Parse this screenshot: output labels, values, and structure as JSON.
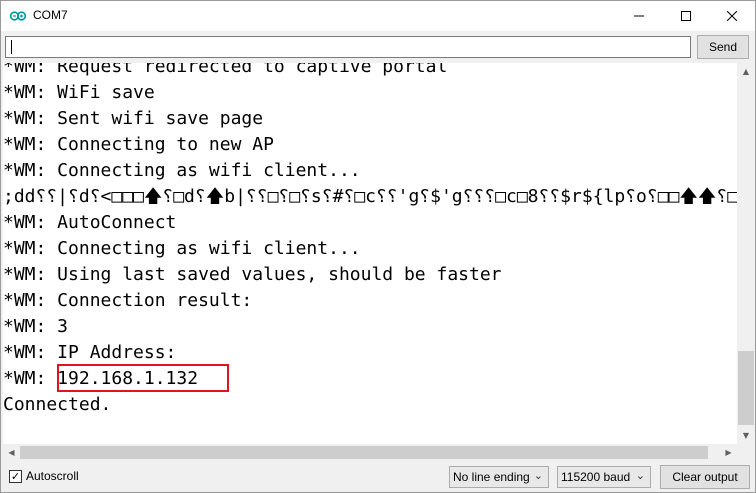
{
  "window": {
    "title": "COM7",
    "icons": {
      "app": "arduino-logo-icon",
      "minimize": "minimize-icon",
      "maximize": "maximize-icon",
      "close": "close-icon"
    }
  },
  "send_row": {
    "input_value": "",
    "send_label": "Send"
  },
  "output": {
    "lines": [
      "*WM: Request redirected to captive portal",
      "*WM: WiFi save",
      "*WM: Sent wifi save page",
      "*WM: Connecting to new AP",
      "*WM: Connecting as wifi client...",
      ";dd⸮⸮|⸮d⸮<□□□🡅⸮□d⸮🡅b|⸮⸮□⸮□⸮s⸮#⸮□c⸮⸮'g⸮$'g⸮⸮⸮□c□8⸮⸮$r${lp⸮o⸮□□🡅🡅⸮□c",
      "*WM: AutoConnect",
      "*WM: Connecting as wifi client...",
      "*WM: Using last saved values, should be faster",
      "*WM: Connection result:",
      "*WM: 3",
      "*WM: IP Address:",
      "*WM: 192.168.1.132",
      "Connected."
    ],
    "highlight_color": "#e0151b"
  },
  "bottom": {
    "autoscroll_label": "Autoscroll",
    "autoscroll_checked": true,
    "line_ending": "No line ending",
    "baud": "115200 baud",
    "clear_label": "Clear output"
  }
}
